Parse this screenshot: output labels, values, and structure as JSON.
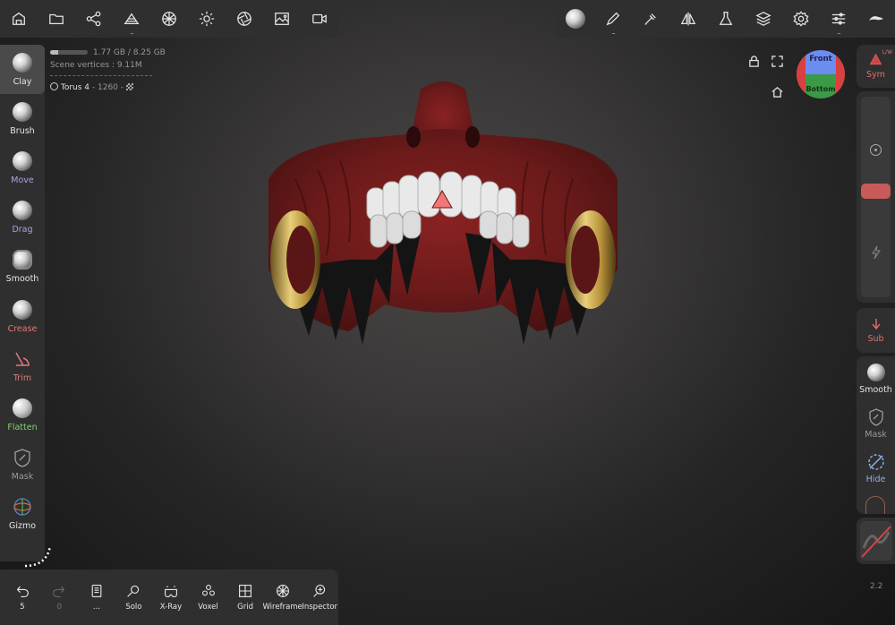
{
  "top_left_toolbar": {
    "buttons": [
      {
        "name": "scene-icon"
      },
      {
        "name": "folder-icon"
      },
      {
        "name": "share-icon"
      },
      {
        "name": "topology-icon"
      },
      {
        "name": "material-icon"
      },
      {
        "name": "light-icon"
      },
      {
        "name": "camera-lens-icon"
      },
      {
        "name": "image-icon"
      },
      {
        "name": "video-icon"
      }
    ]
  },
  "top_right_toolbar": {
    "buttons": [
      {
        "name": "material-sphere-icon"
      },
      {
        "name": "pen-icon"
      },
      {
        "name": "picker-icon"
      },
      {
        "name": "symmetry-icon"
      },
      {
        "name": "flask-icon"
      },
      {
        "name": "layers-icon"
      },
      {
        "name": "settings-icon"
      },
      {
        "name": "sliders-icon"
      },
      {
        "name": "stroke-icon"
      }
    ]
  },
  "info": {
    "memory": "1.77 GB / 8.25 GB",
    "memory_fraction": 0.21,
    "vertices": "Scene vertices : 9.11M",
    "object_name": "Torus 4",
    "object_detail": " - 1260 - "
  },
  "left_tools": [
    {
      "label": "Clay",
      "color": "#e6e6e6",
      "active": true
    },
    {
      "label": "Brush",
      "color": "#e6e6e6"
    },
    {
      "label": "Move",
      "color": "#a9a4e8"
    },
    {
      "label": "Drag",
      "color": "#a9a4e8"
    },
    {
      "label": "Smooth",
      "color": "#e6e6e6"
    },
    {
      "label": "Crease",
      "color": "#e07b7b"
    },
    {
      "label": "Trim",
      "color": "#e07b7b"
    },
    {
      "label": "Flatten",
      "color": "#7fd36a"
    },
    {
      "label": "Mask",
      "color": "#9a9a9a"
    },
    {
      "label": "Gizmo",
      "color": "#e6e6e6"
    }
  ],
  "right_panel": {
    "sym_label": "Sym",
    "sym_badge": "L/W",
    "sub_label": "Sub",
    "smooth_label": "Smooth",
    "mask_label": "Mask",
    "hide_label": "Hide"
  },
  "view_cube": {
    "front": "Front",
    "bottom": "Bottom"
  },
  "bottom_bar": {
    "undo_count": "5",
    "redo_count": "0",
    "buttons": [
      {
        "label": "Solo"
      },
      {
        "label": "X-Ray"
      },
      {
        "label": "Voxel"
      },
      {
        "label": "Grid"
      },
      {
        "label": "Wireframe"
      },
      {
        "label": "Inspector"
      }
    ]
  },
  "zoom": "2.2",
  "colors": {
    "panel": "#2f2f2f",
    "mask_red": "#7a1e1e",
    "teeth": "#e8e8e8",
    "gold": "#c9a24a"
  }
}
